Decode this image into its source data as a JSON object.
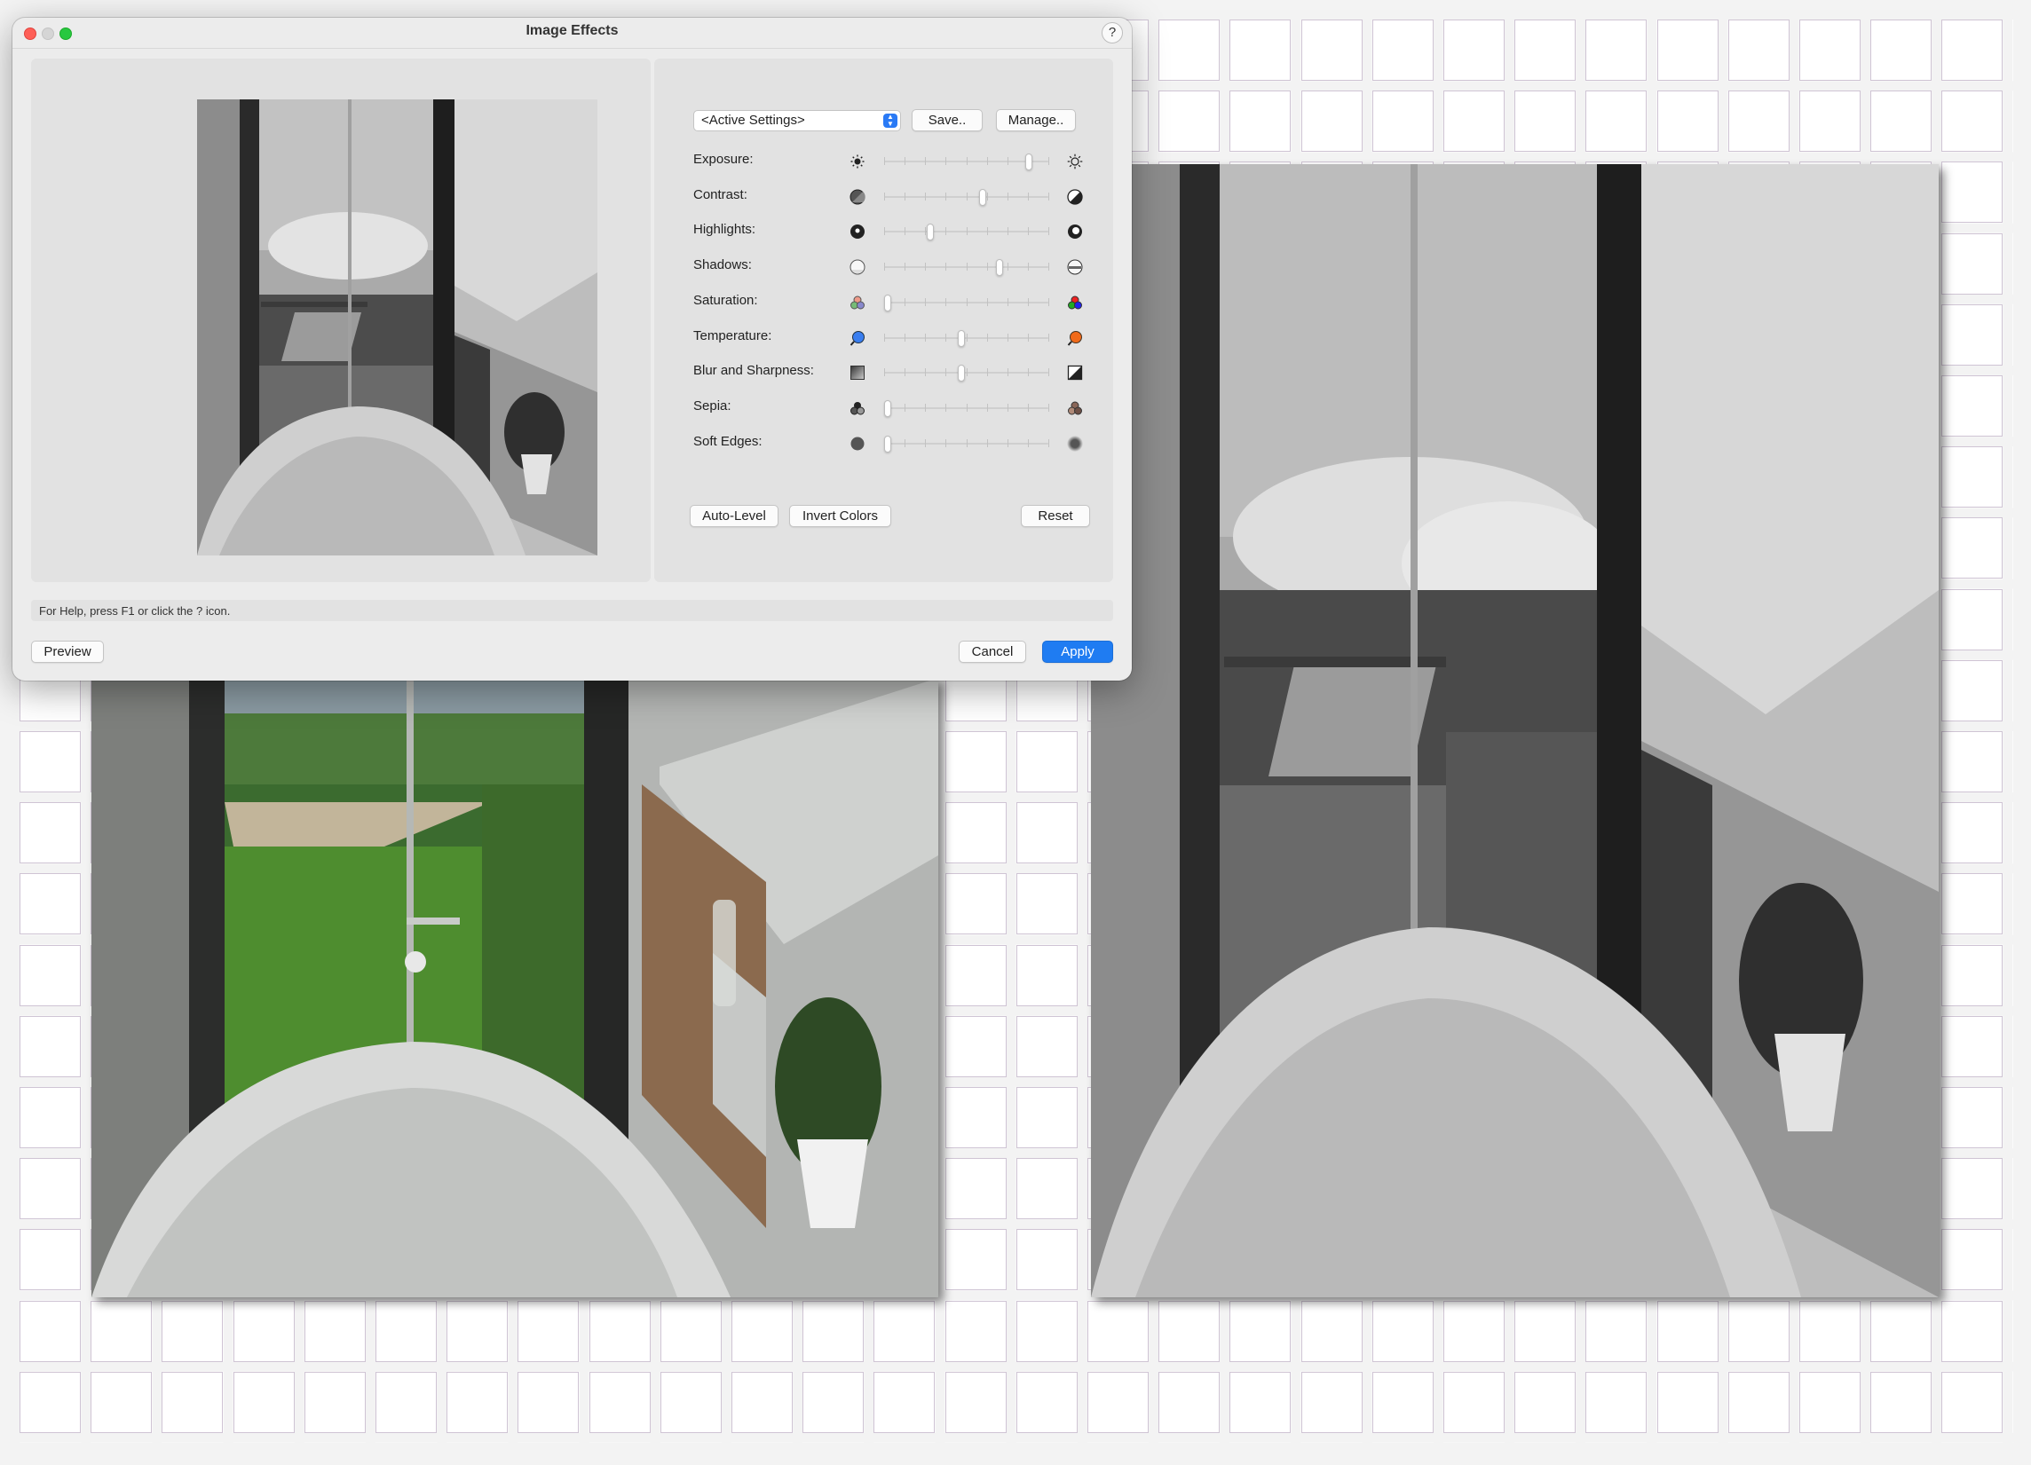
{
  "dialog": {
    "title": "Image Effects",
    "help_button": "?",
    "preset": "<Active Settings>",
    "save_label": "Save..",
    "manage_label": "Manage..",
    "sliders": [
      {
        "label": "Exposure:",
        "value": 0.88,
        "left_icon": "sun-dim-icon",
        "right_icon": "sun-bright-icon"
      },
      {
        "label": "Contrast:",
        "value": 0.6,
        "left_icon": "contrast-low-icon",
        "right_icon": "contrast-high-icon"
      },
      {
        "label": "Highlights:",
        "value": 0.28,
        "left_icon": "highlights-low-icon",
        "right_icon": "highlights-high-icon"
      },
      {
        "label": "Shadows:",
        "value": 0.7,
        "left_icon": "shadows-low-icon",
        "right_icon": "shadows-high-icon"
      },
      {
        "label": "Saturation:",
        "value": 0.02,
        "left_icon": "saturation-low-icon",
        "right_icon": "saturation-high-icon"
      },
      {
        "label": "Temperature:",
        "value": 0.47,
        "left_icon": "temperature-cool-icon",
        "right_icon": "temperature-warm-icon"
      },
      {
        "label": "Blur and Sharpness:",
        "value": 0.47,
        "left_icon": "blur-icon",
        "right_icon": "sharpness-icon"
      },
      {
        "label": "Sepia:",
        "value": 0.02,
        "left_icon": "sepia-low-icon",
        "right_icon": "sepia-high-icon"
      },
      {
        "label": "Soft Edges:",
        "value": 0.02,
        "left_icon": "soft-edges-low-icon",
        "right_icon": "soft-edges-high-icon"
      }
    ],
    "auto_level_label": "Auto-Level",
    "invert_label": "Invert Colors",
    "reset_label": "Reset",
    "help_text": "For Help, press F1 or click the ? icon.",
    "preview_label": "Preview",
    "cancel_label": "Cancel",
    "apply_label": "Apply"
  },
  "colors": {
    "accent": "#1f7cf2",
    "close": "#fe5f57",
    "maximize": "#28c840"
  }
}
